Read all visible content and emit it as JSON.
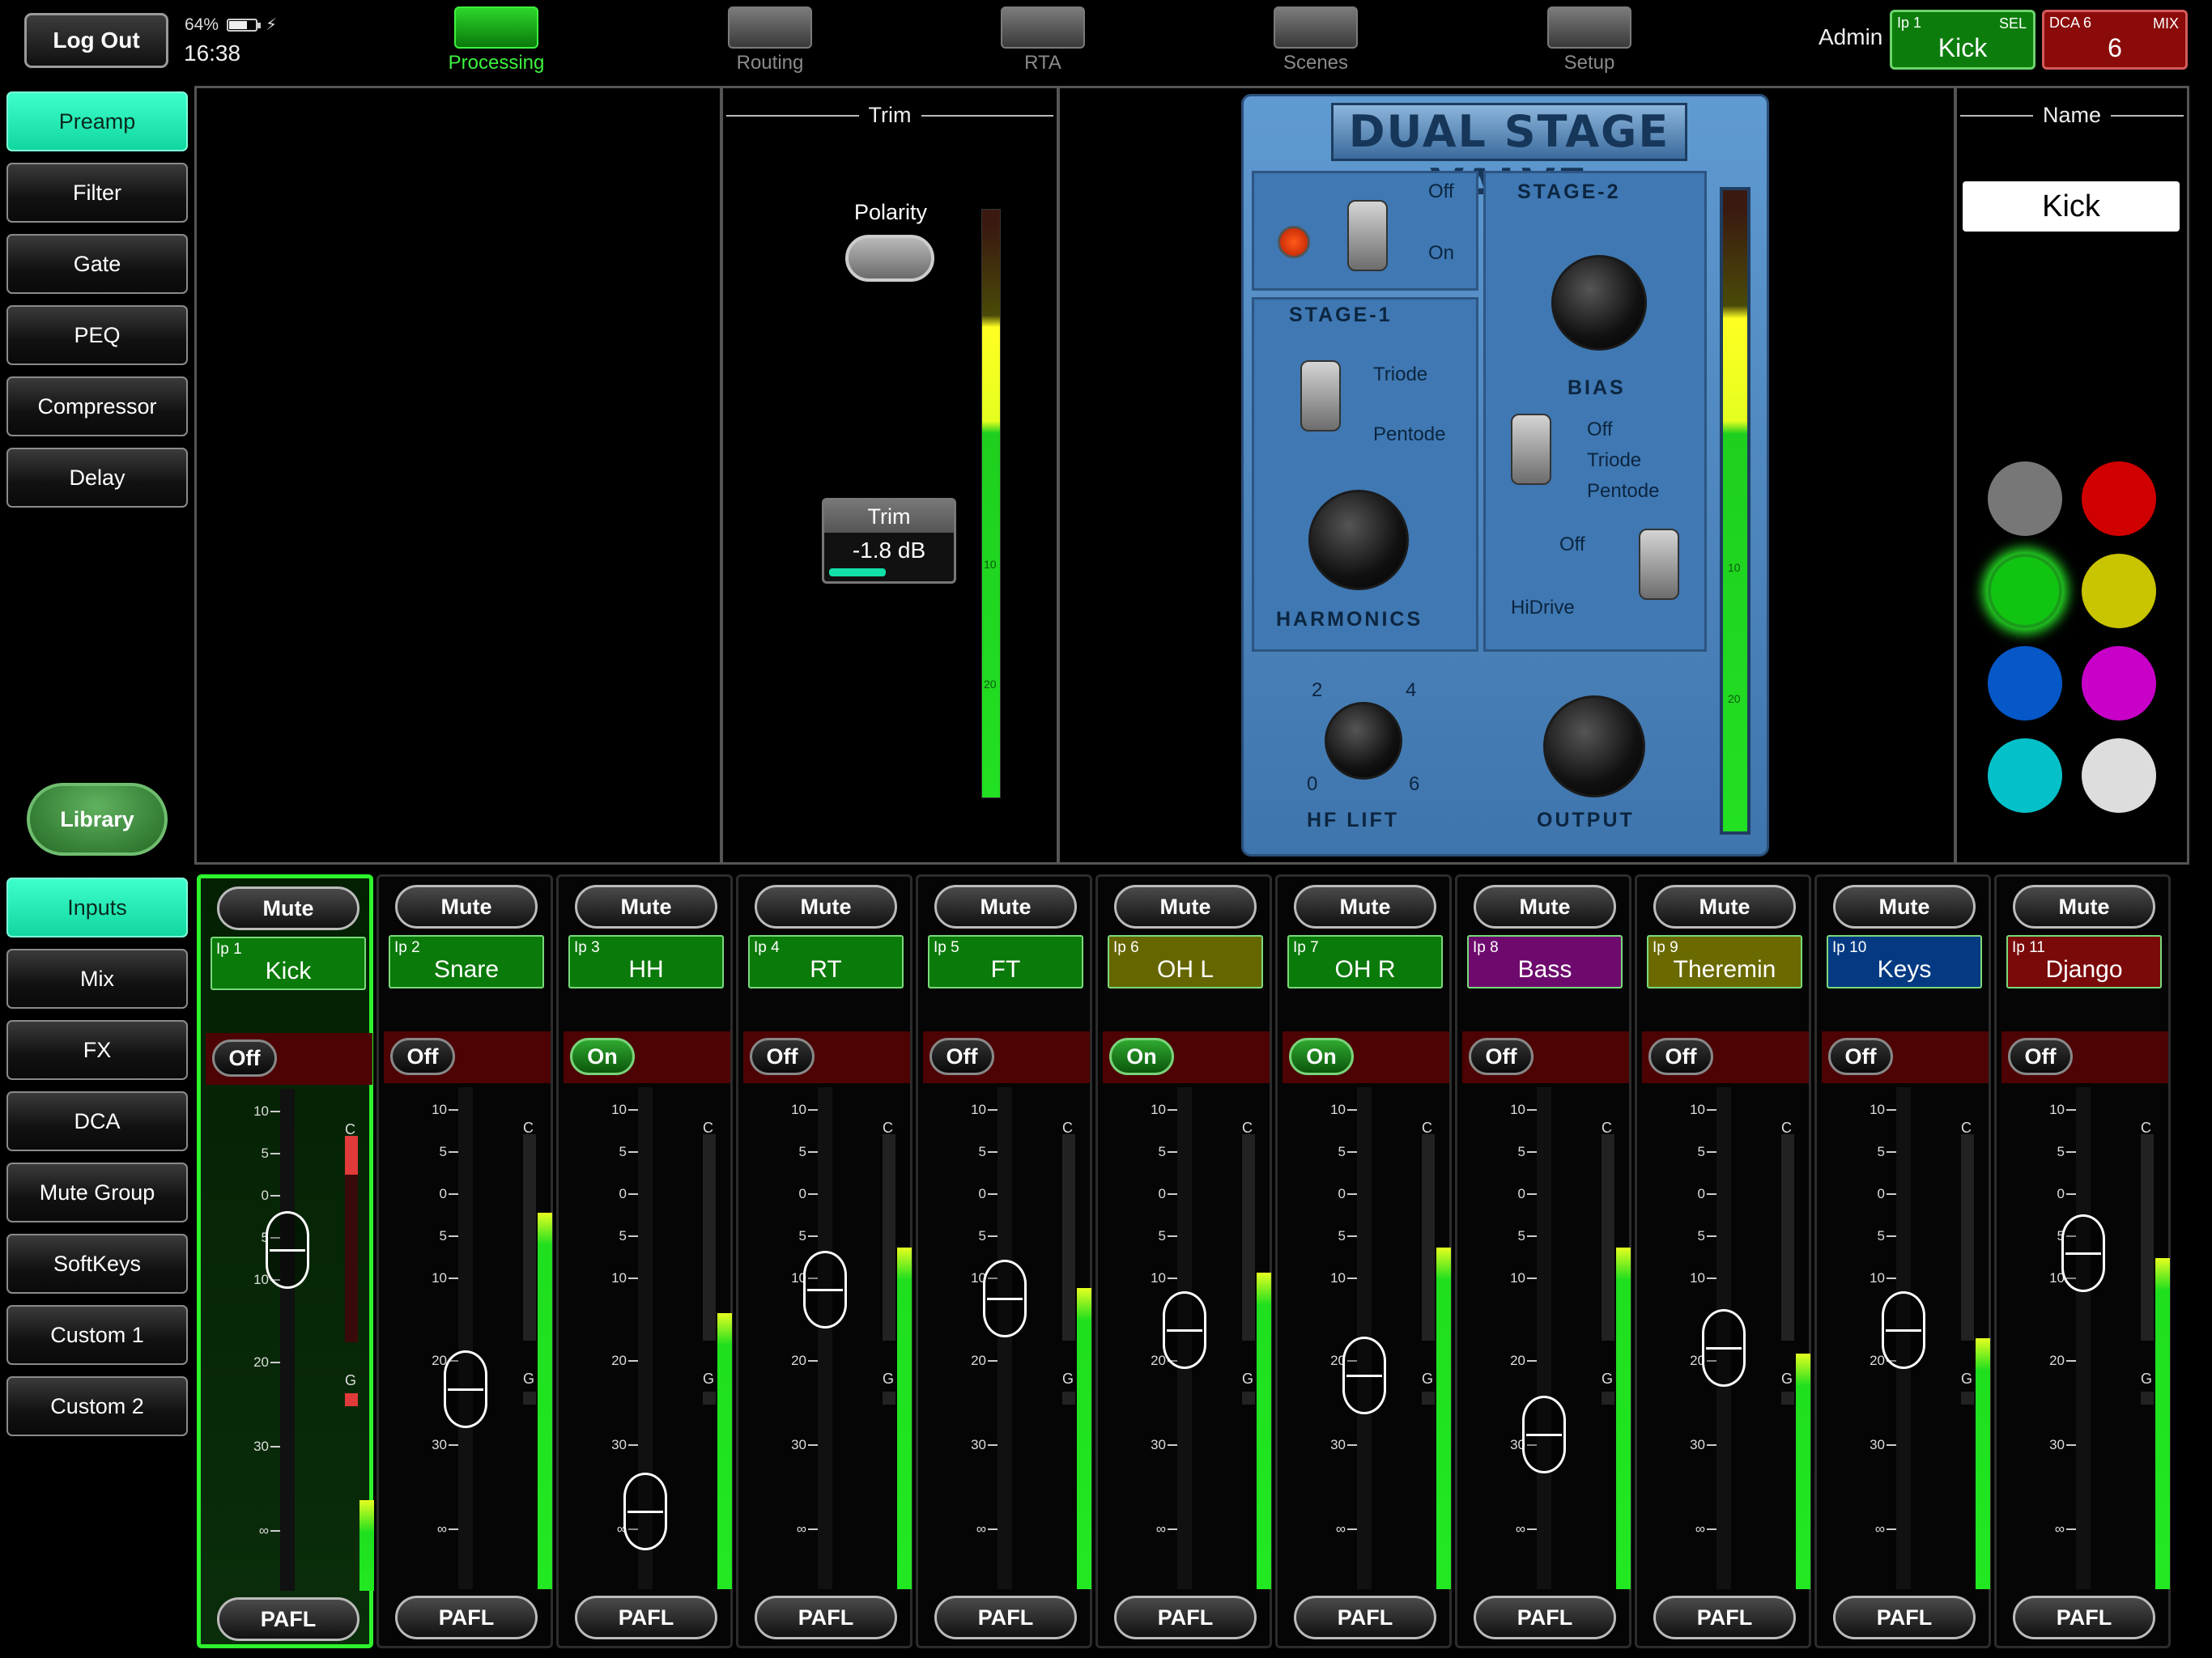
{
  "topbar": {
    "logout_label": "Log Out",
    "battery_percent": "64%",
    "time": "16:38",
    "admin_label": "Admin",
    "nav": [
      "Processing",
      "Routing",
      "RTA",
      "Scenes",
      "Setup"
    ],
    "sel": {
      "ip": "Ip 1",
      "tag": "SEL",
      "name": "Kick"
    },
    "dca": {
      "ip": "DCA 6",
      "tag": "MIX",
      "value": "6"
    }
  },
  "side_top": [
    "Preamp",
    "Filter",
    "Gate",
    "PEQ",
    "Compressor",
    "Delay"
  ],
  "library_label": "Library",
  "side_bottom": [
    "Inputs",
    "Mix",
    "FX",
    "DCA",
    "Mute Group",
    "SoftKeys",
    "Custom 1",
    "Custom 2"
  ],
  "trim": {
    "section_title": "Trim",
    "polarity_label": "Polarity",
    "trim_label": "Trim",
    "trim_value": "-1.8 dB",
    "meter_labels": [
      "10",
      "10",
      "20"
    ]
  },
  "plugin": {
    "title": "DUAL STAGE VALVE",
    "stage1": "STAGE-1",
    "stage2": "STAGE-2",
    "power_off": "Off",
    "power_on": "On",
    "triode": "Triode",
    "pentode": "Pentode",
    "harmonics": "HARMONICS",
    "bias": "BIAS",
    "s2_off": "Off",
    "s2_triode": "Triode",
    "s2_pentode": "Pentode",
    "hidrive_off": "Off",
    "hidrive": "HiDrive",
    "hf_lift": "HF LIFT",
    "hf_ticks": [
      "2",
      "4",
      "0",
      "6"
    ],
    "output": "OUTPUT",
    "meter_labels": [
      "10",
      "10",
      "20"
    ]
  },
  "name_panel": {
    "section_title": "Name",
    "value": "Kick",
    "colors": [
      "#777777",
      "#d10000",
      "#11c411",
      "#c9c400",
      "#0657c8",
      "#c800c8",
      "#04c1c9",
      "#dddddd"
    ]
  },
  "strip_labels": {
    "mute": "Mute",
    "pafl": "PAFL",
    "scale": [
      "10",
      "5",
      "0",
      "5",
      "10",
      "20",
      "30",
      "∞"
    ],
    "c": "C",
    "g": "G"
  },
  "channels": [
    {
      "ip": "Ip 1",
      "name": "Kick",
      "state": "Off",
      "color": "#0a7a0a",
      "fader": 0.27,
      "meter": 0.18
    },
    {
      "ip": "Ip 2",
      "name": "Snare",
      "state": "Off",
      "color": "#0a7a0a",
      "fader": 0.58,
      "meter": 0.75
    },
    {
      "ip": "Ip 3",
      "name": "HH",
      "state": "On",
      "color": "#0a7a0a",
      "fader": 0.85,
      "meter": 0.55
    },
    {
      "ip": "Ip 4",
      "name": "RT",
      "state": "Off",
      "color": "#0a7a0a",
      "fader": 0.36,
      "meter": 0.68
    },
    {
      "ip": "Ip 5",
      "name": "FT",
      "state": "Off",
      "color": "#0a7a0a",
      "fader": 0.38,
      "meter": 0.6
    },
    {
      "ip": "Ip 6",
      "name": "OH L",
      "state": "On",
      "color": "#666600",
      "fader": 0.45,
      "meter": 0.63
    },
    {
      "ip": "Ip 7",
      "name": "OH R",
      "state": "On",
      "color": "#0a7a0a",
      "fader": 0.55,
      "meter": 0.68
    },
    {
      "ip": "Ip 8",
      "name": "Bass",
      "state": "Off",
      "color": "#6e0a6e",
      "fader": 0.68,
      "meter": 0.68
    },
    {
      "ip": "Ip 9",
      "name": "Theremin",
      "state": "Off",
      "color": "#6a6a00",
      "fader": 0.49,
      "meter": 0.47
    },
    {
      "ip": "Ip 10",
      "name": "Keys",
      "state": "Off",
      "color": "#053a83",
      "fader": 0.45,
      "meter": 0.5
    },
    {
      "ip": "Ip 11",
      "name": "Django",
      "state": "Off",
      "color": "#7a0a0a",
      "fader": 0.28,
      "meter": 0.66
    }
  ]
}
